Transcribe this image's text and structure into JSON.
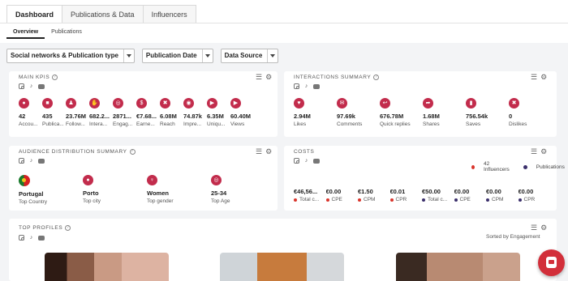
{
  "tabs": [
    "Dashboard",
    "Publications & Data",
    "Influencers"
  ],
  "subtabs": [
    "Overview",
    "Publications"
  ],
  "filters": [
    "Social networks & Publication type",
    "Publication Date",
    "Data Source"
  ],
  "main_kpis": {
    "title": "MAIN KPIS",
    "items": [
      {
        "value": "42",
        "label": "Accou...",
        "icon": "person-icon"
      },
      {
        "value": "435",
        "label": "Publica...",
        "icon": "publication-icon"
      },
      {
        "value": "23.76M",
        "label": "Follow...",
        "icon": "followers-icon"
      },
      {
        "value": "682.2...",
        "label": "Intera...",
        "icon": "interaction-icon"
      },
      {
        "value": "2871...",
        "label": "Engag...",
        "icon": "target-icon"
      },
      {
        "value": "€7.68...",
        "label": "Earne...",
        "icon": "dollar-icon"
      },
      {
        "value": "6.08M",
        "label": "Reach",
        "icon": "reach-icon"
      },
      {
        "value": "74.87k",
        "label": "Impre...",
        "icon": "eye-icon"
      },
      {
        "value": "6.35M",
        "label": "Uniqu...",
        "icon": "play-icon"
      },
      {
        "value": "60.40M",
        "label": "Views",
        "icon": "views-icon"
      }
    ]
  },
  "interactions": {
    "title": "INTERACTIONS SUMMARY",
    "items": [
      {
        "value": "2.94M",
        "label": "Likes",
        "icon": "heart-icon"
      },
      {
        "value": "97.69k",
        "label": "Comments",
        "icon": "comment-icon"
      },
      {
        "value": "676.78M",
        "label": "Quick replies",
        "icon": "reply-icon"
      },
      {
        "value": "1.68M",
        "label": "Shares",
        "icon": "share-icon"
      },
      {
        "value": "756.54k",
        "label": "Saves",
        "icon": "bookmark-icon"
      },
      {
        "value": "0",
        "label": "Dislikes",
        "icon": "dislike-icon"
      }
    ]
  },
  "audience": {
    "title": "AUDIENCE DISTRIBUTION SUMMARY",
    "items": [
      {
        "value": "Portugal",
        "label": "Top Country",
        "icon": "portugal-flag-icon"
      },
      {
        "value": "Porto",
        "label": "Top city",
        "icon": "location-pin-icon"
      },
      {
        "value": "Women",
        "label": "Top gender",
        "icon": "gender-icon"
      },
      {
        "value": "25-34",
        "label": "Top Age",
        "icon": "target-icon"
      }
    ]
  },
  "costs": {
    "title": "COSTS",
    "legend": [
      {
        "label": "42 Influencers",
        "color": "#d9342b"
      },
      {
        "label": "Publications",
        "color": "#3b2f6b"
      }
    ],
    "items": [
      {
        "value": "€46,56...",
        "label": "Total c...",
        "color": "#d9342b"
      },
      {
        "value": "€0.00",
        "label": "CPE",
        "color": "#d9342b"
      },
      {
        "value": "€1.50",
        "label": "CPM",
        "color": "#d9342b"
      },
      {
        "value": "€0.01",
        "label": "CPR",
        "color": "#d9342b"
      },
      {
        "value": "€50.00",
        "label": "Total c...",
        "color": "#3b2f6b"
      },
      {
        "value": "€0.00",
        "label": "CPE",
        "color": "#3b2f6b"
      },
      {
        "value": "€0.00",
        "label": "CPM",
        "color": "#3b2f6b"
      },
      {
        "value": "€0.00",
        "label": "CPR",
        "color": "#3b2f6b"
      }
    ]
  },
  "top_profiles": {
    "title": "TOP PROFILES",
    "sorted": "Sorted by Engagement"
  },
  "accent": "#c22c4c"
}
